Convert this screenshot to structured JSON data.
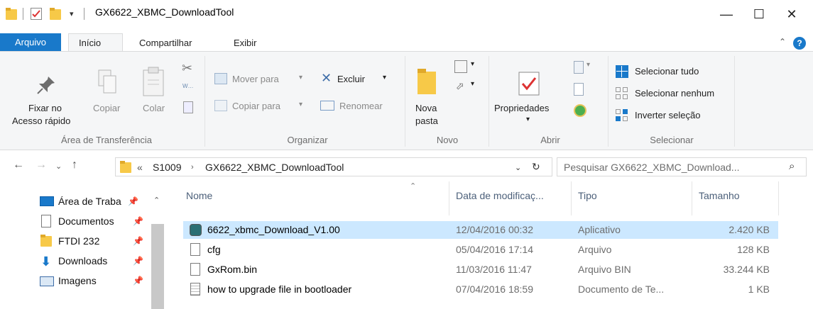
{
  "window": {
    "title": "GX6622_XBMC_DownloadTool",
    "controls": {
      "minimize": "—",
      "maximize": "☐",
      "close": "✕"
    }
  },
  "ribbon_tabs": {
    "file": "Arquivo",
    "home": "Início",
    "share": "Compartilhar",
    "view": "Exibir"
  },
  "ribbon": {
    "clipboard": {
      "pin_line1": "Fixar no",
      "pin_line2": "Acesso rápido",
      "copy": "Copiar",
      "paste": "Colar",
      "label": "Área de Transferência"
    },
    "organize": {
      "move_to": "Mover para",
      "copy_to": "Copiar para",
      "delete": "Excluir",
      "rename": "Renomear",
      "label": "Organizar"
    },
    "new": {
      "new_folder_line1": "Nova",
      "new_folder_line2": "pasta",
      "label": "Novo"
    },
    "open": {
      "properties": "Propriedades",
      "label": "Abrir"
    },
    "select": {
      "select_all": "Selecionar tudo",
      "select_none": "Selecionar nenhum",
      "invert": "Inverter seleção",
      "label": "Selecionar"
    }
  },
  "address": {
    "overflow": "«",
    "crumbs": [
      "S1009",
      "GX6622_XBMC_DownloadTool"
    ],
    "search_placeholder": "Pesquisar GX6622_XBMC_Download..."
  },
  "nav_pane": [
    {
      "label": "Área de Traba",
      "icon": "desktop-icon"
    },
    {
      "label": "Documentos",
      "icon": "documents-icon"
    },
    {
      "label": "FTDI 232",
      "icon": "folder-icon"
    },
    {
      "label": "Downloads",
      "icon": "downloads-icon"
    },
    {
      "label": "Imagens",
      "icon": "pictures-icon"
    }
  ],
  "file_list": {
    "columns": [
      "Nome",
      "Data de modificaç...",
      "Tipo",
      "Tamanho"
    ],
    "rows": [
      {
        "name": "6622_xbmc_Download_V1.00",
        "date": "12/04/2016 00:32",
        "type": "Aplicativo",
        "size": "2.420 KB",
        "selected": true,
        "icon": "application-icon"
      },
      {
        "name": "cfg",
        "date": "05/04/2016 17:14",
        "type": "Arquivo",
        "size": "128 KB",
        "selected": false,
        "icon": "file-icon"
      },
      {
        "name": "GxRom.bin",
        "date": "11/03/2016 11:47",
        "type": "Arquivo BIN",
        "size": "33.244 KB",
        "selected": false,
        "icon": "file-icon"
      },
      {
        "name": "how to upgrade file in bootloader",
        "date": "07/04/2016 18:59",
        "type": "Documento de Te...",
        "size": "1 KB",
        "selected": false,
        "icon": "text-document-icon"
      }
    ]
  },
  "colors": {
    "accent": "#1979ca",
    "selection": "#cce8ff",
    "folder": "#f7c948"
  }
}
